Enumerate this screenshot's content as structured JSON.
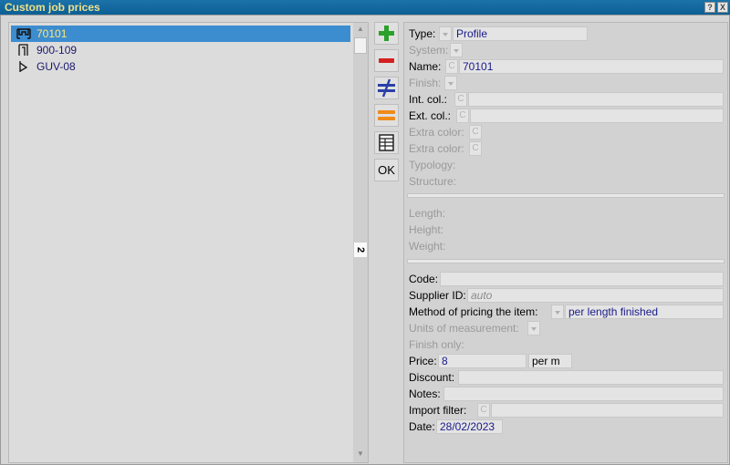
{
  "window": {
    "title": "Custom job prices",
    "help_label": "?",
    "close_label": "X"
  },
  "list": {
    "items": [
      {
        "label": "70101",
        "icon": "profile-section-icon",
        "selected": true
      },
      {
        "label": "900-109",
        "icon": "frame-profile-icon",
        "selected": false
      },
      {
        "label": "GUV-08",
        "icon": "gasket-profile-icon",
        "selected": false
      }
    ],
    "scroll_counter": "2"
  },
  "toolbar": {
    "add_icon": "plus-icon",
    "remove_icon": "minus-icon",
    "different_icon": "not-equal-icon",
    "equal_icon": "equal-icon",
    "table_icon": "table-icon",
    "ok_label": "OK",
    "colors": {
      "add": "#2aa12a",
      "remove": "#d42020",
      "different": "#2b3fa8",
      "equal": "#f08a18"
    }
  },
  "form": {
    "type": {
      "label": "Type:",
      "value": "Profile"
    },
    "system": {
      "label": "System:"
    },
    "name": {
      "label": "Name:",
      "c": "C",
      "value": "70101"
    },
    "finish": {
      "label": "Finish:"
    },
    "int_col": {
      "label": "Int. col.:",
      "c": "C",
      "value": ""
    },
    "ext_col": {
      "label": "Ext. col.:",
      "c": "C",
      "value": ""
    },
    "extra_color_1": {
      "label": "Extra color:",
      "c": "C"
    },
    "extra_color_2": {
      "label": "Extra color:",
      "c": "C"
    },
    "typology": {
      "label": "Typology:"
    },
    "structure": {
      "label": "Structure:"
    },
    "length": {
      "label": "Length:"
    },
    "height": {
      "label": "Height:"
    },
    "weight": {
      "label": "Weight:"
    },
    "code": {
      "label": "Code:",
      "value": ""
    },
    "supplier_id": {
      "label": "Supplier ID:",
      "value": "auto"
    },
    "pricing_method": {
      "label": "Method of pricing the item:",
      "value": "per length finished"
    },
    "units": {
      "label": "Units of measurement:"
    },
    "finish_only": {
      "label": "Finish only:"
    },
    "price": {
      "label": "Price:",
      "value": "8",
      "unit": "per m"
    },
    "discount": {
      "label": "Discount:",
      "value": ""
    },
    "notes": {
      "label": "Notes:",
      "value": ""
    },
    "import_filter": {
      "label": "Import filter:",
      "c": "C",
      "value": ""
    },
    "date": {
      "label": "Date:",
      "value": "28/02/2023"
    }
  }
}
